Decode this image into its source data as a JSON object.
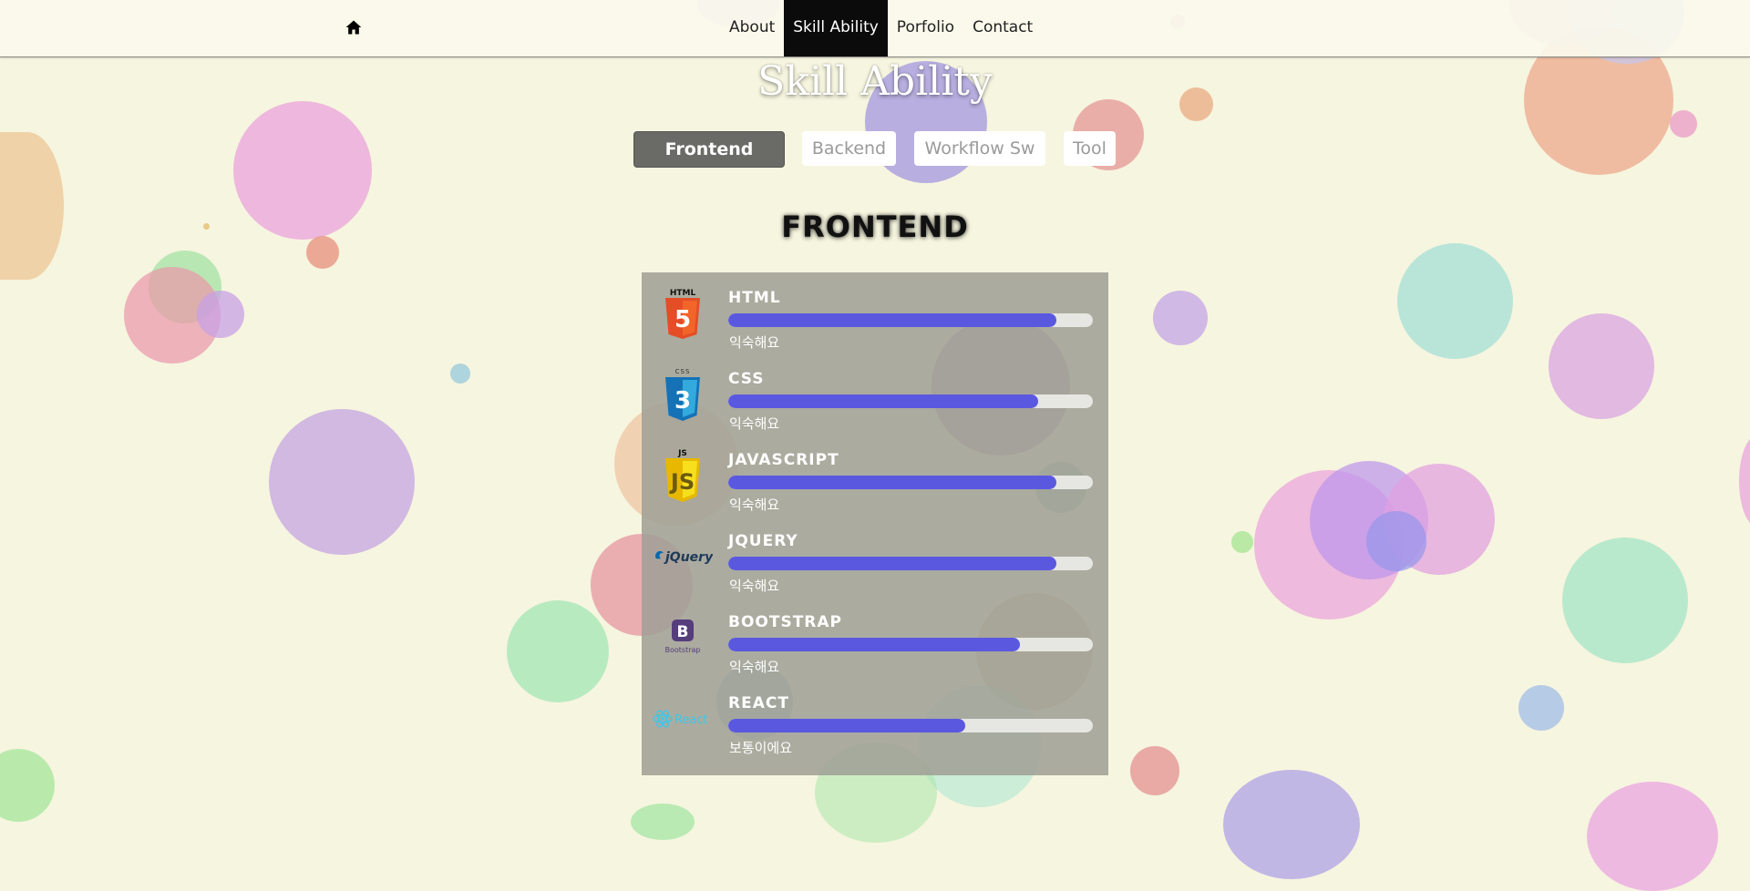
{
  "nav": {
    "menu": [
      {
        "label": "About",
        "active": false
      },
      {
        "label": "Skill Ability",
        "active": true
      },
      {
        "label": "Porfolio",
        "active": false
      },
      {
        "label": "Contact",
        "active": false
      }
    ]
  },
  "page_title": "Skill Ability",
  "tabs": [
    {
      "label": "Frontend",
      "active": true
    },
    {
      "label": "Backend",
      "active": false
    },
    {
      "label": "Workflow Sw",
      "active": false
    },
    {
      "label": "Tool",
      "active": false
    }
  ],
  "section_title": "FRONTEND",
  "skills": [
    {
      "name": "HTML",
      "level_text": "익숙해요",
      "progress_percent": 90,
      "icon": "html5-icon"
    },
    {
      "name": "CSS",
      "level_text": "익숙해요",
      "progress_percent": 85,
      "icon": "css3-icon"
    },
    {
      "name": "JAVASCRIPT",
      "level_text": "익숙해요",
      "progress_percent": 90,
      "icon": "javascript-icon"
    },
    {
      "name": "JQUERY",
      "level_text": "익숙해요",
      "progress_percent": 90,
      "icon": "jquery-icon"
    },
    {
      "name": "BOOTSTRAP",
      "level_text": "익숙해요",
      "progress_percent": 80,
      "icon": "bootstrap-icon"
    },
    {
      "name": "REACT",
      "level_text": "보통이에요",
      "progress_percent": 65,
      "icon": "react-icon"
    }
  ],
  "logo_text": {
    "html": "HTML",
    "css": "CSS",
    "js": "JS",
    "jquery": "jQuery",
    "bootstrap": "Bootstrap",
    "react": "React"
  },
  "colors": {
    "progress_fill": "#5b58e0",
    "active_nav_bg": "#0b0b0b",
    "active_tab_bg": "#6a6a66",
    "page_bg": "#f6f5df"
  }
}
